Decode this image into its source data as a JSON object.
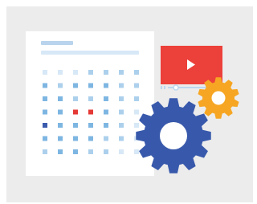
{
  "illustration": {
    "subject": "calendar-with-video-and-gears",
    "colors": {
      "background": "#ececec",
      "card": "#ffffff",
      "header_bar": "#b9d4ec",
      "cell_pale": "#d7e8f6",
      "cell_light": "#acd0ec",
      "cell_mid": "#7eb6e2",
      "cell_dark": "#3b5bad",
      "cell_red": "#e53935",
      "video_red": "#ec403a",
      "play_white": "#ffffff",
      "timeline": "#bcd7ee",
      "gear_blue": "#3859ab",
      "gear_orange": "#f6a623"
    },
    "calendar_grid": {
      "rows": 7,
      "cols": 7,
      "highlighted_red": [
        [
          3,
          2
        ],
        [
          3,
          3
        ]
      ],
      "highlighted_dark": [
        [
          4,
          0
        ]
      ]
    }
  }
}
